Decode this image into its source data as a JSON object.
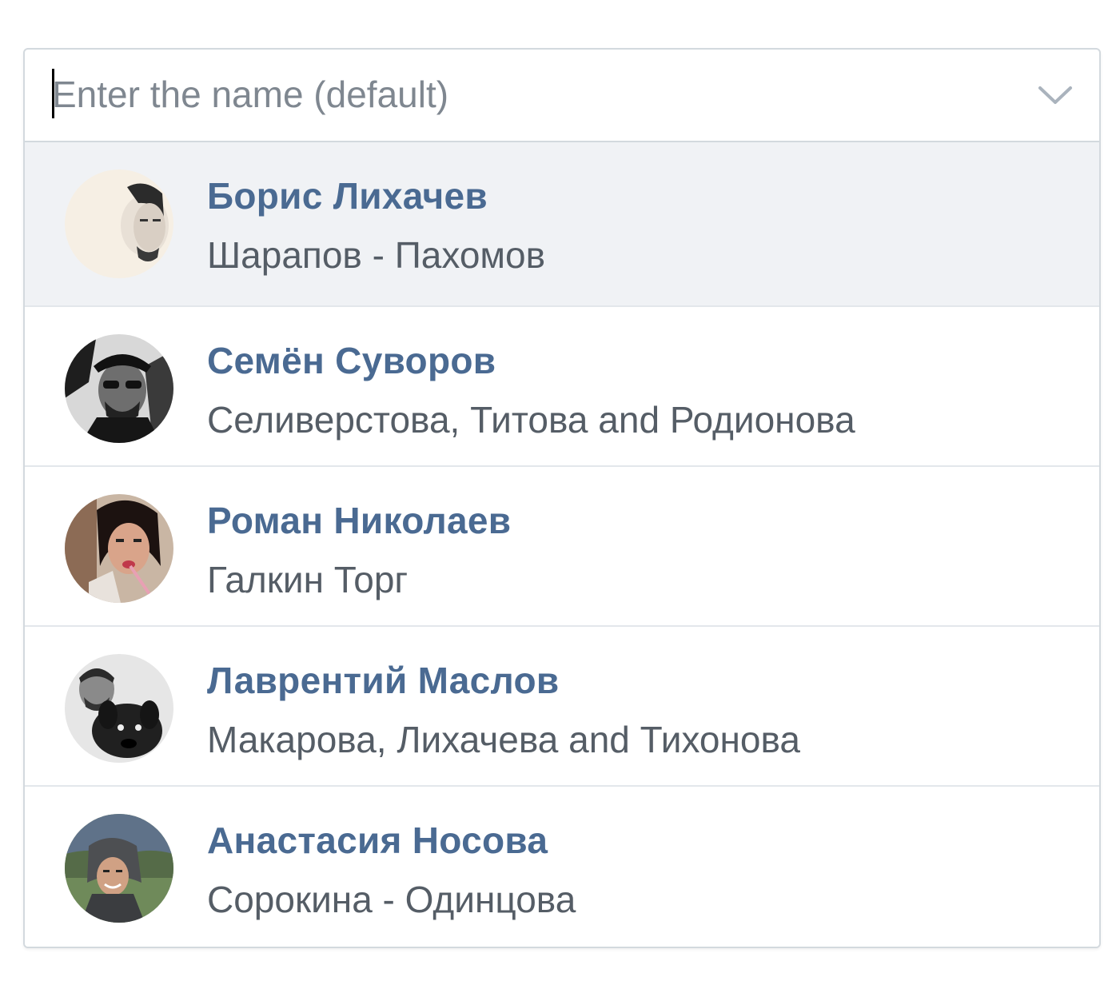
{
  "input": {
    "placeholder": "Enter the name (default)",
    "value": ""
  },
  "toggle_icon": "chevron-down-icon",
  "colors": {
    "name": "#4a6a92",
    "description": "#555d66",
    "highlight": "#f0f2f5",
    "border": "#d3d9de"
  },
  "options": [
    {
      "name": "Борис Лихачев",
      "description": "Шарапов - Пахомов",
      "active": true,
      "avatar": "user-photo"
    },
    {
      "name": "Семён Суворов",
      "description": "Селиверстова, Титова and Родионова",
      "active": false,
      "avatar": "user-photo"
    },
    {
      "name": "Роман Николаев",
      "description": "Галкин Торг",
      "active": false,
      "avatar": "user-photo"
    },
    {
      "name": "Лаврентий Маслов",
      "description": "Макарова, Лихачева and Тихонова",
      "active": false,
      "avatar": "user-photo"
    },
    {
      "name": "Анастасия Носова",
      "description": "Сорокина - Одинцова",
      "active": false,
      "avatar": "user-photo"
    }
  ]
}
